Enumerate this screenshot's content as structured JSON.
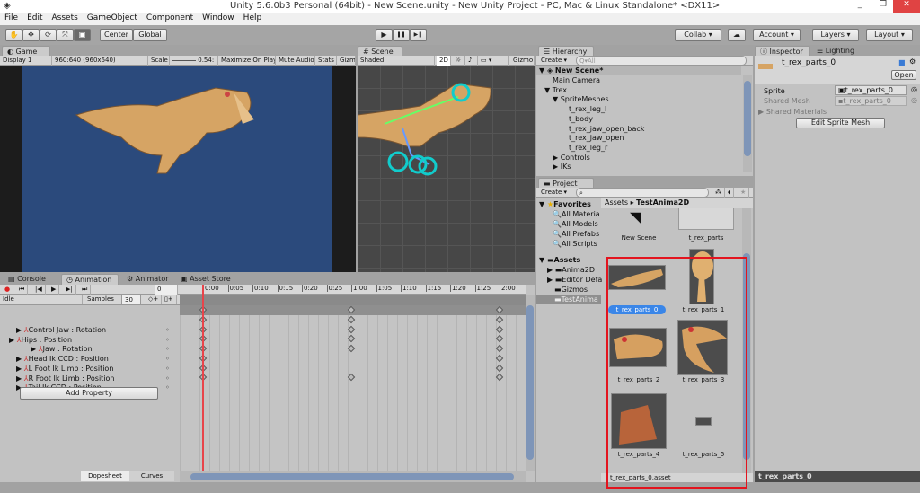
{
  "window": {
    "title": "Unity 5.6.0b3 Personal (64bit) - New Scene.unity - New Unity Project - PC, Mac & Linux Standalone* <DX11>",
    "minimize": "_",
    "maximize": "❐",
    "close": "✕",
    "close_color": "#e04343"
  },
  "menu": [
    "File",
    "Edit",
    "Assets",
    "GameObject",
    "Component",
    "Window",
    "Help"
  ],
  "toolbar": {
    "tools": [
      "hand-tool",
      "move-tool",
      "rotate-tool",
      "scale-tool",
      "rect-tool"
    ],
    "pivot": "Center",
    "space": "Global",
    "play": "▶",
    "pause": "❚❚",
    "step": "▶❚",
    "collab": "Collab ▾",
    "cloud": "☁",
    "account": "Account",
    "layers": "Layers",
    "layout": "Layout"
  },
  "game": {
    "tab": "Game",
    "display": "Display 1",
    "resolution": "960:640 (960x640)",
    "scale_label": "Scale",
    "scale_value": "0.54:",
    "maximize": "Maximize On Play",
    "mute": "Mute Audio",
    "stats": "Stats",
    "gizmos": "Gizm",
    "bg_color": "#2b4a7c"
  },
  "scene": {
    "tab": "Scene",
    "shading": "Shaded",
    "mode2d": "2D",
    "gizmos": "Gizmo"
  },
  "animation": {
    "tabs": [
      "Console",
      "Animation",
      "Animator",
      "Asset Store"
    ],
    "frame": "0",
    "clip": "Idle",
    "samples_label": "Samples",
    "samples": "30",
    "time_labels": [
      "0:00",
      "0:05",
      "0:10",
      "0:15",
      "0:20",
      "0:25",
      "1:00",
      "1:05",
      "1:10",
      "1:15",
      "1:20",
      "1:25",
      "2:00"
    ],
    "properties": [
      {
        "label": "Control Jaw : Rotation",
        "indent": 1,
        "keys": [
          0,
          1,
          2
        ]
      },
      {
        "label": "Hips : Position",
        "indent": 0,
        "keys": [
          0,
          1,
          2
        ]
      },
      {
        "label": "Jaw : Rotation",
        "indent": 3,
        "keys": [
          0,
          1,
          2
        ]
      },
      {
        "label": "Head Ik CCD : Position",
        "indent": 1,
        "keys": [
          0,
          1,
          2
        ]
      },
      {
        "label": "L Foot Ik Limb : Position",
        "indent": 1,
        "keys": [
          0,
          2
        ]
      },
      {
        "label": "R Foot Ik Limb : Position",
        "indent": 1,
        "keys": [
          0,
          2
        ]
      },
      {
        "label": "Tail Ik CCD : Position",
        "indent": 1,
        "keys": [
          0,
          1,
          2
        ]
      }
    ],
    "summary_keys": [
      0,
      1,
      2
    ],
    "add_property": "Add Property",
    "dopesheet": "Dopesheet",
    "curves": "Curves",
    "playhead_color": "#e8444a"
  },
  "hierarchy": {
    "tab": "Hierarchy",
    "create": "Create ▾",
    "search_placeholder": "Q▾All",
    "scene": "New Scene*",
    "items": [
      {
        "label": "Main Camera",
        "indent": 1,
        "arrow": ""
      },
      {
        "label": "Trex",
        "indent": 1,
        "arrow": "▼"
      },
      {
        "label": "SpriteMeshes",
        "indent": 2,
        "arrow": "▼"
      },
      {
        "label": "t_rex_leg_l",
        "indent": 3,
        "arrow": ""
      },
      {
        "label": "t_body",
        "indent": 3,
        "arrow": ""
      },
      {
        "label": "t_rex_jaw_open_back",
        "indent": 3,
        "arrow": ""
      },
      {
        "label": "t_rex_jaw_open",
        "indent": 3,
        "arrow": ""
      },
      {
        "label": "t_rex_leg_r",
        "indent": 3,
        "arrow": ""
      },
      {
        "label": "Controls",
        "indent": 2,
        "arrow": "▶"
      },
      {
        "label": "IKs",
        "indent": 2,
        "arrow": "▶"
      }
    ]
  },
  "project": {
    "tab": "Project",
    "create": "Create ▾",
    "favorites": "Favorites",
    "fav_items": [
      "All Materia",
      "All Models",
      "All Prefabs",
      "All Scripts"
    ],
    "assets": "Assets",
    "folders": [
      "Anima2D",
      "Editor Defa",
      "Gizmos",
      "TestAnima"
    ],
    "breadcrumb_root": "Assets",
    "breadcrumb_current": "TestAnima2D",
    "top_items": [
      "New Scene",
      "t_rex_parts"
    ],
    "grid": [
      "t_rex_parts_0",
      "t_rex_parts_1",
      "t_rex_parts_2",
      "t_rex_parts_3",
      "t_rex_parts_4",
      "t_rex_parts_5"
    ],
    "selected": "t_rex_parts_0",
    "footer": "t_rex_parts_0.asset",
    "highlight_color": "#e3141e"
  },
  "inspector": {
    "tab": "Inspector",
    "tab2": "Lighting",
    "name": "t_rex_parts_0",
    "open": "Open",
    "sprite_label": "Sprite",
    "sprite_value": "t_rex_parts_0",
    "mesh_label": "Shared Mesh",
    "mesh_value": "t_rex_parts_0",
    "materials_label": "Shared Materials",
    "edit_button": "Edit Sprite Mesh",
    "preview_label": "t_rex_parts_0"
  }
}
